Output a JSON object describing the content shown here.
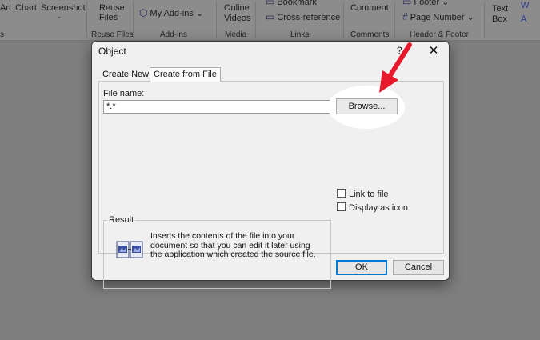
{
  "ribbon": {
    "insert_buttons": [
      "Art",
      "Chart",
      "Screenshot"
    ],
    "reuse_files": "Reuse Files",
    "reuse_files_group": "Reuse Files",
    "my_addins": "My Add-ins",
    "addins_group": "Add-ins",
    "online_videos": "Online Videos",
    "media_group": "Media",
    "bookmark": "Bookmark",
    "cross_reference": "Cross-reference",
    "links_group": "Links",
    "comment": "Comment",
    "comments_group": "Comments",
    "footer": "Footer",
    "page_number": "Page Number",
    "header_footer_group": "Header & Footer",
    "text_box": "Text Box",
    "left_group": "s"
  },
  "dialog": {
    "title": "Object",
    "help": "?",
    "close": "✕",
    "tabs": [
      "Create New",
      "Create from File"
    ],
    "active_tab": "Create from File",
    "file_name_label": "File name:",
    "file_name_value": "*.*",
    "browse_label": "Browse...",
    "link_to_file_label": "Link to file",
    "link_to_file_checked": false,
    "display_as_icon_label": "Display as icon",
    "display_as_icon_checked": false,
    "result_label": "Result",
    "result_text": "Inserts the contents of the file into your document so that you can edit it later using the application which created the source file.",
    "ok_label": "OK",
    "cancel_label": "Cancel"
  },
  "colors": {
    "annotation_arrow": "#e8192c",
    "default_button_border": "#0078d4"
  }
}
